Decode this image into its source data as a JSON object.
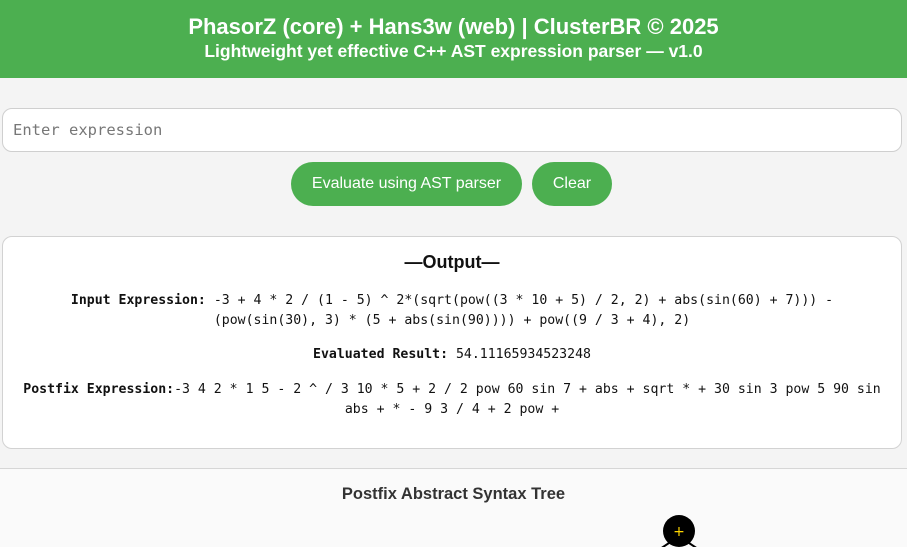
{
  "header": {
    "title": "PhasorZ (core) + Hans3w (web) | ClusterBR © 2025",
    "subtitle": "Lightweight yet effective C++ AST expression parser — v1.0"
  },
  "input": {
    "placeholder": "Enter expression",
    "value": ""
  },
  "buttons": {
    "evaluate_label": "Evaluate using AST parser",
    "clear_label": "Clear"
  },
  "output": {
    "heading": "—Output—",
    "input_label": "Input Expression:",
    "input_value": " -3 + 4 * 2 / (1 - 5) ^ 2*(sqrt(pow((3 * 10 + 5) / 2, 2) + abs(sin(60) + 7))) - (pow(sin(30), 3) * (5 + abs(sin(90)))) + pow((9 / 3 + 4), 2)",
    "result_label": "Evaluated Result:",
    "result_value": " 54.11165934523248",
    "postfix_label": "Postfix Expression:",
    "postfix_value": "-3 4 2 * 1 5 - 2 ^ / 3 10 * 5 + 2 / 2 pow 60 sin 7 + abs + sqrt * + 30 sin 3 pow 5 90 sin abs + * - 9 3 / 4 + 2 pow +"
  },
  "tree": {
    "title": "Postfix Abstract Syntax Tree",
    "root_label": "+",
    "colors": {
      "node_fill": "#000000",
      "node_text": "#ffd600"
    }
  },
  "colors": {
    "accent": "#4caf50",
    "background": "#f4f4f4",
    "card": "#ffffff"
  }
}
